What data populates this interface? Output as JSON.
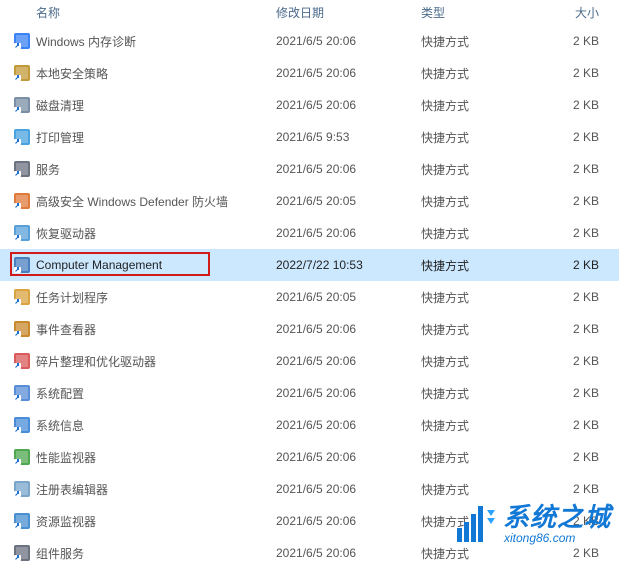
{
  "columns": {
    "name": "名称",
    "date": "修改日期",
    "type": "类型",
    "size": "大小"
  },
  "highlight_index": 7,
  "items": [
    {
      "name": "Windows 内存诊断",
      "date": "2021/6/5 20:06",
      "type": "快捷方式",
      "size": "2 KB",
      "icon": "memory-diag-icon"
    },
    {
      "name": "本地安全策略",
      "date": "2021/6/5 20:06",
      "type": "快捷方式",
      "size": "2 KB",
      "icon": "security-policy-icon"
    },
    {
      "name": "磁盘清理",
      "date": "2021/6/5 20:06",
      "type": "快捷方式",
      "size": "2 KB",
      "icon": "disk-cleanup-icon"
    },
    {
      "name": "打印管理",
      "date": "2021/6/5 9:53",
      "type": "快捷方式",
      "size": "2 KB",
      "icon": "print-mgmt-icon"
    },
    {
      "name": "服务",
      "date": "2021/6/5 20:06",
      "type": "快捷方式",
      "size": "2 KB",
      "icon": "services-icon"
    },
    {
      "name": "高级安全 Windows Defender 防火墙",
      "date": "2021/6/5 20:05",
      "type": "快捷方式",
      "size": "2 KB",
      "icon": "firewall-icon"
    },
    {
      "name": "恢复驱动器",
      "date": "2021/6/5 20:06",
      "type": "快捷方式",
      "size": "2 KB",
      "icon": "recovery-drive-icon"
    },
    {
      "name": "Computer Management",
      "date": "2022/7/22 10:53",
      "type": "快捷方式",
      "size": "2 KB",
      "icon": "computer-mgmt-icon"
    },
    {
      "name": "任务计划程序",
      "date": "2021/6/5 20:05",
      "type": "快捷方式",
      "size": "2 KB",
      "icon": "task-scheduler-icon"
    },
    {
      "name": "事件查看器",
      "date": "2021/6/5 20:06",
      "type": "快捷方式",
      "size": "2 KB",
      "icon": "event-viewer-icon"
    },
    {
      "name": "碎片整理和优化驱动器",
      "date": "2021/6/5 20:06",
      "type": "快捷方式",
      "size": "2 KB",
      "icon": "defrag-icon"
    },
    {
      "name": "系统配置",
      "date": "2021/6/5 20:06",
      "type": "快捷方式",
      "size": "2 KB",
      "icon": "system-config-icon"
    },
    {
      "name": "系统信息",
      "date": "2021/6/5 20:06",
      "type": "快捷方式",
      "size": "2 KB",
      "icon": "system-info-icon"
    },
    {
      "name": "性能监视器",
      "date": "2021/6/5 20:06",
      "type": "快捷方式",
      "size": "2 KB",
      "icon": "perf-monitor-icon"
    },
    {
      "name": "注册表编辑器",
      "date": "2021/6/5 20:06",
      "type": "快捷方式",
      "size": "2 KB",
      "icon": "regedit-icon"
    },
    {
      "name": "资源监视器",
      "date": "2021/6/5 20:06",
      "type": "快捷方式",
      "size": "2 KB",
      "icon": "resource-monitor-icon"
    },
    {
      "name": "组件服务",
      "date": "2021/6/5 20:06",
      "type": "快捷方式",
      "size": "2 KB",
      "icon": "component-services-icon"
    }
  ],
  "watermark": {
    "main": "系统之城",
    "sub": "xitong86.com"
  }
}
